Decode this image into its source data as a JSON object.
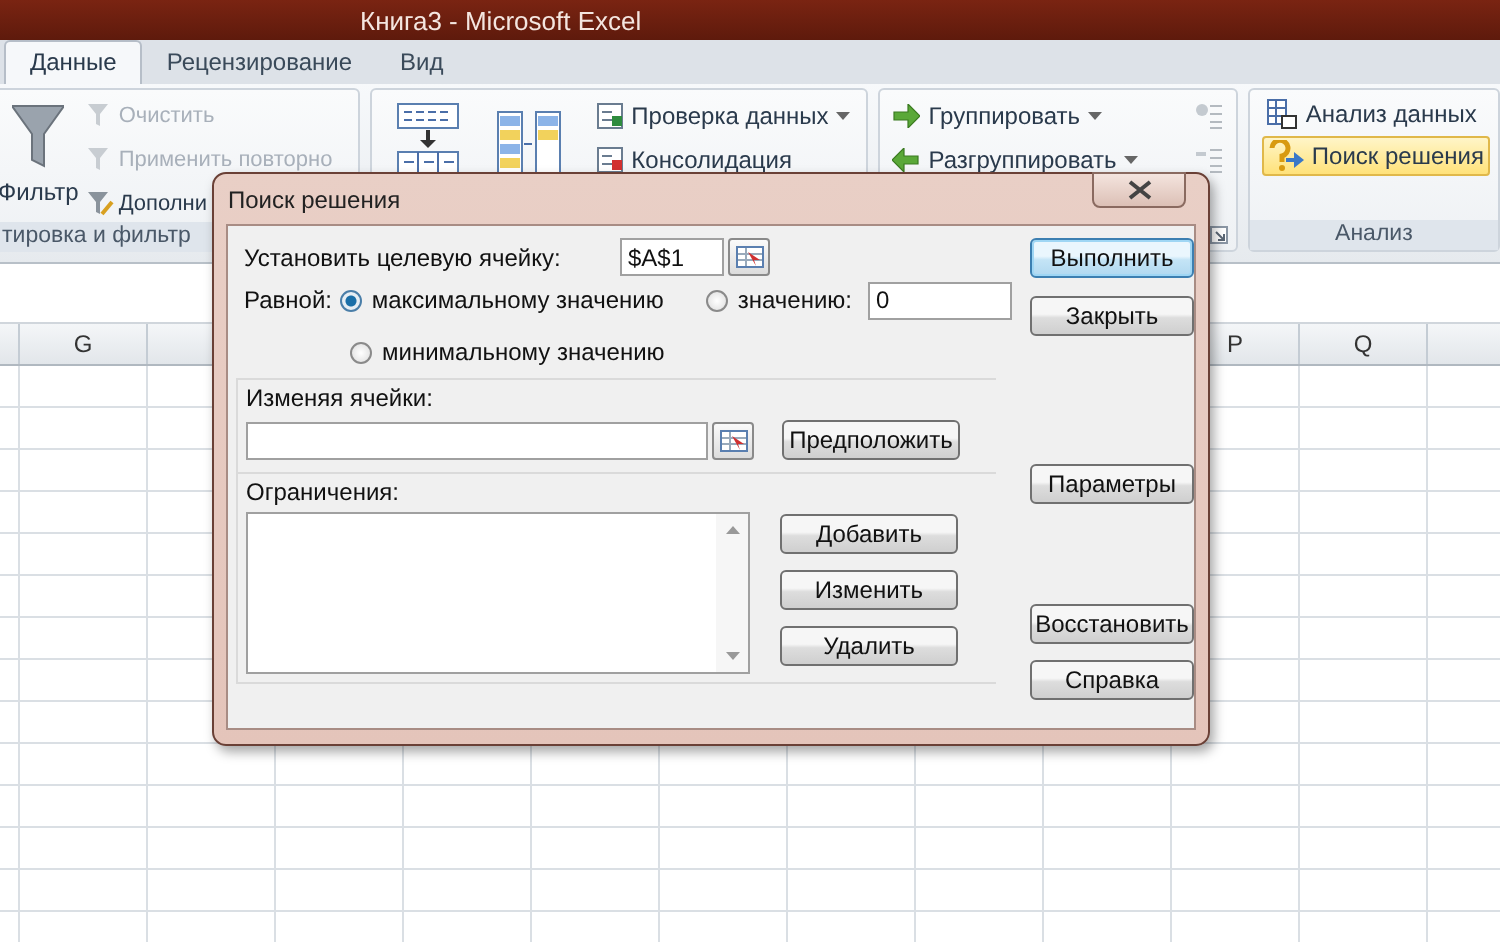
{
  "window": {
    "title": "Книга3 - Microsoft Excel"
  },
  "tabs": [
    {
      "label": "Данные",
      "selected": true
    },
    {
      "label": "Рецензирование",
      "selected": false
    },
    {
      "label": "Вид",
      "selected": false
    }
  ],
  "sort_filter": {
    "label": "тировка и фильтр",
    "filter_button": "Фильтр",
    "items": [
      {
        "label": "Очистить",
        "disabled": true
      },
      {
        "label": "Применить повторно",
        "disabled": true
      },
      {
        "label": "Дополни",
        "disabled": false
      }
    ]
  },
  "data_tools": {
    "items": [
      {
        "label": "Проверка данных",
        "dropdown": true
      },
      {
        "label": "Консолидация",
        "dropdown": false
      }
    ]
  },
  "outline": {
    "items": [
      {
        "label": "Группировать",
        "dropdown": true
      },
      {
        "label": "Разгруппировать",
        "dropdown": true
      }
    ]
  },
  "analysis": {
    "label": "Анализ",
    "items": [
      {
        "label": "Анализ данных",
        "highlighted": false
      },
      {
        "label": "Поиск решения",
        "highlighted": true
      }
    ]
  },
  "sheet": {
    "columns": [
      "G",
      "P",
      "Q"
    ]
  },
  "dialog": {
    "title": "Поиск решения",
    "target_label": "Установить целевую ячейку:",
    "target_value": "$A$1",
    "equal_label": "Равной:",
    "options": [
      {
        "label": "максимальному значению",
        "selected": true
      },
      {
        "label": "значению:",
        "selected": false
      },
      {
        "label": "минимальному значению",
        "selected": false
      }
    ],
    "value_field": "0",
    "changing_label": "Изменяя ячейки:",
    "guess_button": "Предположить",
    "constraints_label": "Ограничения:",
    "constraint_buttons": [
      "Добавить",
      "Изменить",
      "Удалить"
    ],
    "side_button_groups": [
      {
        "buttons": [
          {
            "label": "Выполнить",
            "default": true
          },
          {
            "label": "Закрыть",
            "default": false
          }
        ]
      },
      {
        "buttons": [
          {
            "label": "Параметры",
            "default": false
          }
        ]
      },
      {
        "buttons": [
          {
            "label": "Восстановить",
            "default": false
          },
          {
            "label": "Справка",
            "default": false
          }
        ]
      }
    ]
  }
}
